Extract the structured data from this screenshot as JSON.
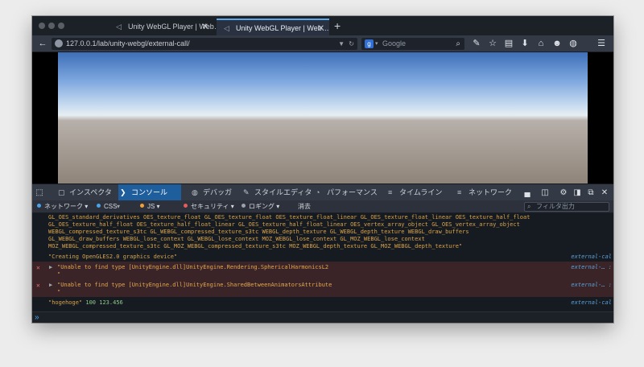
{
  "browser": {
    "tabs": [
      {
        "title": "Unity WebGL Player | Web…",
        "close": "✕",
        "active": false
      },
      {
        "title": "Unity WebGL Player | Web…",
        "close": "✕",
        "active": true
      }
    ],
    "new_tab": "+",
    "url": "127.0.0.1/lab/unity-webgl/external-call/",
    "search_placeholder": "Google",
    "search_engine": "g",
    "icons": [
      "wrench-icon",
      "star-icon",
      "clipboard-icon",
      "download-icon",
      "home-icon",
      "chat-icon",
      "addon-icon",
      "menu-icon"
    ]
  },
  "devtools": {
    "tabs": [
      {
        "label": "インスペクタ",
        "icon": "▢"
      },
      {
        "label": "コンソール",
        "icon": "❯",
        "active": true
      },
      {
        "label": "デバッガ",
        "icon": "◍"
      },
      {
        "label": "スタイルエディタ",
        "icon": "✎"
      },
      {
        "label": "パフォーマンス",
        "icon": "◔"
      },
      {
        "label": "タイムライン",
        "icon": "≡"
      },
      {
        "label": "ネットワーク",
        "icon": "≡"
      }
    ],
    "filters": [
      {
        "label": "ネットワーク ▾",
        "color": "#4aa3e8"
      },
      {
        "label": "CSS",
        "color": "#4aa3e8"
      },
      {
        "label": "JS ▾",
        "color": "#f0a03a"
      },
      {
        "label": "セキュリティ ▾",
        "color": "#e35d5d"
      },
      {
        "label": "ロギング ▾",
        "color": "#9aa2ad"
      }
    ],
    "clear": "消去",
    "filter_placeholder": "フィルタ出力"
  },
  "console": {
    "lines": [
      "GL_OES_standard_derivatives OES_texture_float GL_OES_texture_float OES_texture_float_linear GL_OES_texture_float_linear OES_texture_half_float",
      "GL_OES_texture_half_float OES_texture_half_float_linear GL_OES_texture_half_float_linear OES_vertex_array_object GL_OES_vertex_array_object",
      "WEBGL_compressed_texture_s3tc GL_WEBGL_compressed_texture_s3tc WEBGL_depth_texture GL_WEBGL_depth_texture WEBGL_draw_buffers",
      "GL_WEBGL_draw_buffers WEBGL_lose_context GL_WEBGL_lose_context MOZ_WEBGL_lose_context GL_MOZ_WEBGL_lose_context",
      "MOZ_WEBGL_compressed_texture_s3tc GL_MOZ_WEBGL_compressed_texture_s3tc MOZ_WEBGL_depth_texture GL_MOZ_WEBGL_depth_texture\"",
      "\"Creating OpenGLES2.0 graphics device\""
    ],
    "src_main": "external-cal",
    "errors": [
      {
        "msg": "\"Unable to find type [UnityEngine.dll]UnityEngine.Rendering.SphericalHarmonicsL2",
        "quote": "\"",
        "src": "external-… :"
      },
      {
        "msg": "\"Unable to find type [UnityEngine.dll]UnityEngine.SharedBetweenAnimatorsAttribute",
        "quote": "\"",
        "src": "external-… :"
      }
    ],
    "output": {
      "str": "\"hogehoge\"",
      "n1": "100",
      "n2": "123.456",
      "src": "external-cal"
    },
    "prompt": "»"
  }
}
